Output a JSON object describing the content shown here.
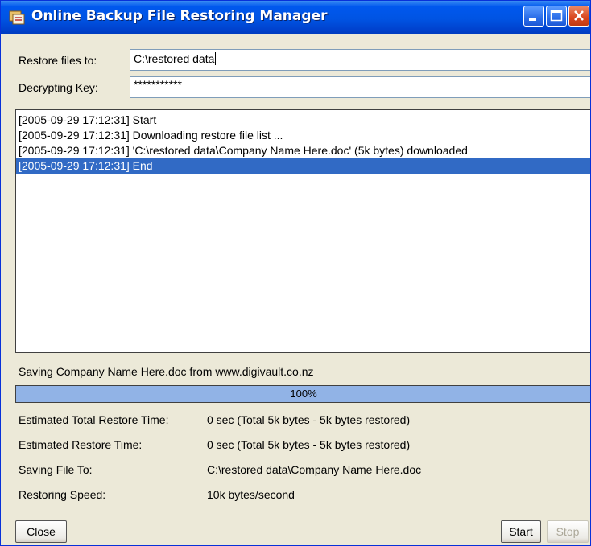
{
  "window": {
    "title": "Online Backup File Restoring Manager",
    "title_bar_color": "#0054e3",
    "controls": {
      "minimize_icon": "minimize-icon",
      "maximize_icon": "maximize-icon",
      "close_icon": "close-icon"
    }
  },
  "form": {
    "restore_to_label": "Restore files to:",
    "restore_to_value": "C:\\restored data",
    "key_label": "Decrypting Key:",
    "key_value": "***********"
  },
  "log": {
    "lines": [
      "[2005-09-29 17:12:31] Start",
      "[2005-09-29 17:12:31] Downloading restore file list ...",
      "[2005-09-29 17:12:31] 'C:\\restored data\\Company Name Here.doc' (5k bytes) downloaded",
      "[2005-09-29 17:12:31] End"
    ],
    "selected_index": 3,
    "selection_color": "#316ac5"
  },
  "status": {
    "message": "Saving Company Name Here.doc from www.digivault.co.nz",
    "progress_percent": 100,
    "progress_label": "100%",
    "progress_color": "#91b3e6"
  },
  "details": [
    {
      "label": "Estimated Total Restore Time:",
      "value": "0 sec (Total 5k bytes - 5k bytes restored)"
    },
    {
      "label": "Estimated Restore Time:",
      "value": "0 sec (Total 5k bytes - 5k bytes restored)"
    },
    {
      "label": "Saving File To:",
      "value": "C:\\restored data\\Company Name Here.doc"
    },
    {
      "label": "Restoring Speed:",
      "value": "10k bytes/second"
    }
  ],
  "buttons": {
    "close": "Close",
    "start": "Start",
    "stop": "Stop"
  }
}
